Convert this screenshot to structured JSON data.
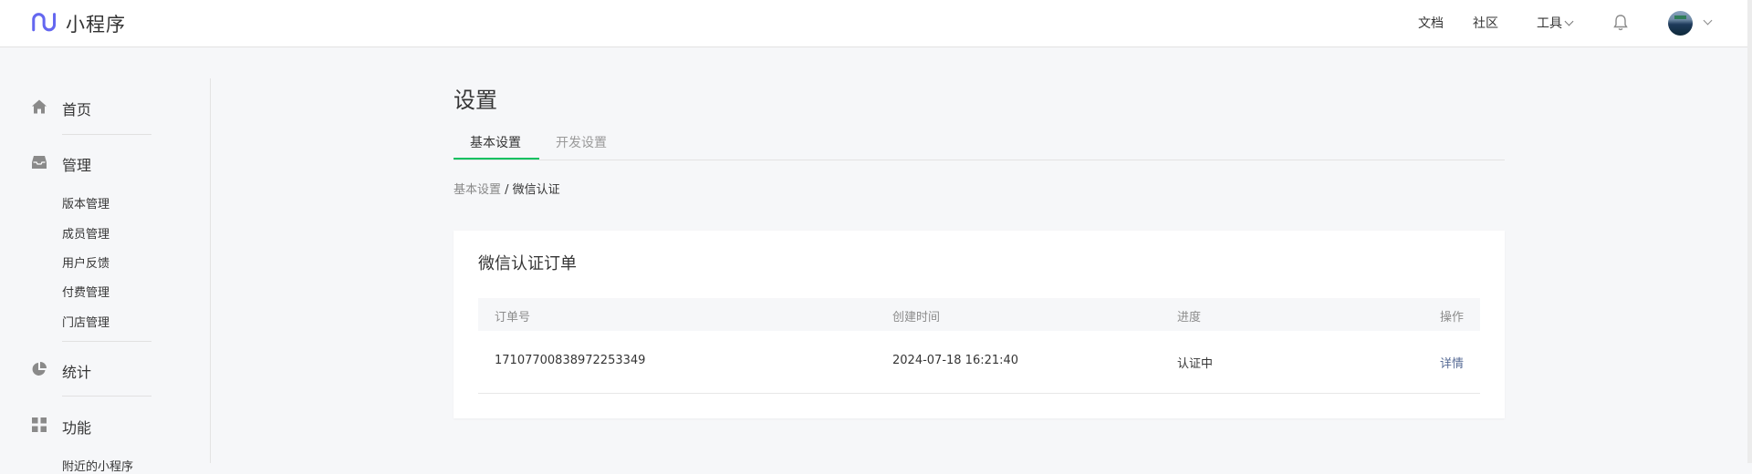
{
  "header": {
    "brand": "小程序",
    "nav": {
      "docs": "文档",
      "community": "社区",
      "tools": "工具"
    },
    "icons": {
      "logo": "mini-program-logo",
      "bell": "bell-icon",
      "avatar": "user-avatar",
      "chevron": "chevron-down-icon"
    }
  },
  "sidebar": {
    "home": {
      "label": "首页",
      "icon": "home-icon"
    },
    "manage": {
      "label": "管理",
      "icon": "inbox-icon",
      "items": [
        "版本管理",
        "成员管理",
        "用户反馈",
        "付费管理",
        "门店管理"
      ]
    },
    "stats": {
      "label": "统计",
      "icon": "pie-chart-icon"
    },
    "features": {
      "label": "功能",
      "icon": "grid-icon",
      "next_item_partial": "附近的小程序"
    }
  },
  "main": {
    "title": "设置",
    "tabs": [
      {
        "label": "基本设置",
        "active": true
      },
      {
        "label": "开发设置",
        "active": false
      }
    ],
    "breadcrumb": {
      "parent": "基本设置",
      "separator": " / ",
      "current": "微信认证"
    },
    "card": {
      "title": "微信认证订单",
      "columns": [
        "订单号",
        "创建时间",
        "进度",
        "操作"
      ],
      "rows": [
        {
          "order_no": "17107700838972253349",
          "created": "2024-07-18 16:21:40",
          "status": "认证中",
          "action": "详情"
        }
      ]
    }
  },
  "colors": {
    "accent_green": "#07c160",
    "link_blue": "#576b95",
    "brand_purple": "#6467f0"
  }
}
